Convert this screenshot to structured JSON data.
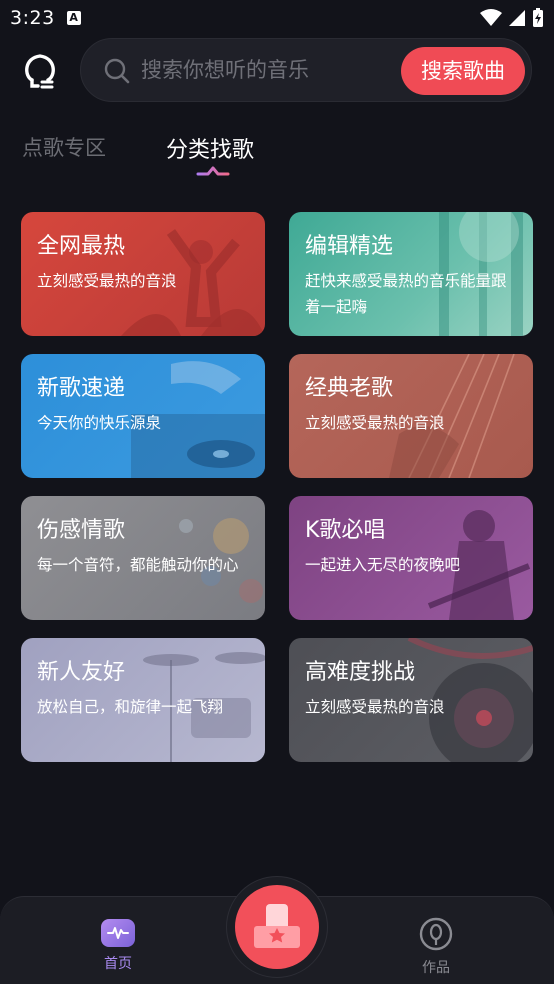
{
  "status_bar": {
    "time": "3:23",
    "badge": "A"
  },
  "search": {
    "placeholder": "搜索你想听的音乐",
    "button_label": "搜索歌曲"
  },
  "tabs": [
    {
      "label": "点歌专区",
      "active": false
    },
    {
      "label": "分类找歌",
      "active": true
    }
  ],
  "cards": [
    {
      "title": "全网最热",
      "desc": "立刻感受最热的音浪",
      "color": "#d2473e"
    },
    {
      "title": "编辑精选",
      "desc": "赶快来感受最热的音乐能量跟着一起嗨",
      "color": "#4fb5a2"
    },
    {
      "title": "新歌速递",
      "desc": "今天你的快乐源泉",
      "color": "#3a93d6"
    },
    {
      "title": "经典老歌",
      "desc": "立刻感受最热的音浪",
      "color": "#b8685a"
    },
    {
      "title": "伤感情歌",
      "desc": "每一个音符，都能触动你的心",
      "color": "#8a8a8f"
    },
    {
      "title": "K歌必唱",
      "desc": "一起进入无尽的夜晚吧",
      "color": "#8d4a8f"
    },
    {
      "title": "新人友好",
      "desc": "放松自己，和旋律一起飞翔",
      "color": "#9c9dbb"
    },
    {
      "title": "高难度挑战",
      "desc": "立刻感受最热的音浪",
      "color": "#55565c"
    }
  ],
  "bottom_nav": {
    "home_label": "首页",
    "works_label": "作品"
  },
  "colors": {
    "accent": "#f04b55",
    "background": "#12131a",
    "active_nav": "#a98af0"
  }
}
